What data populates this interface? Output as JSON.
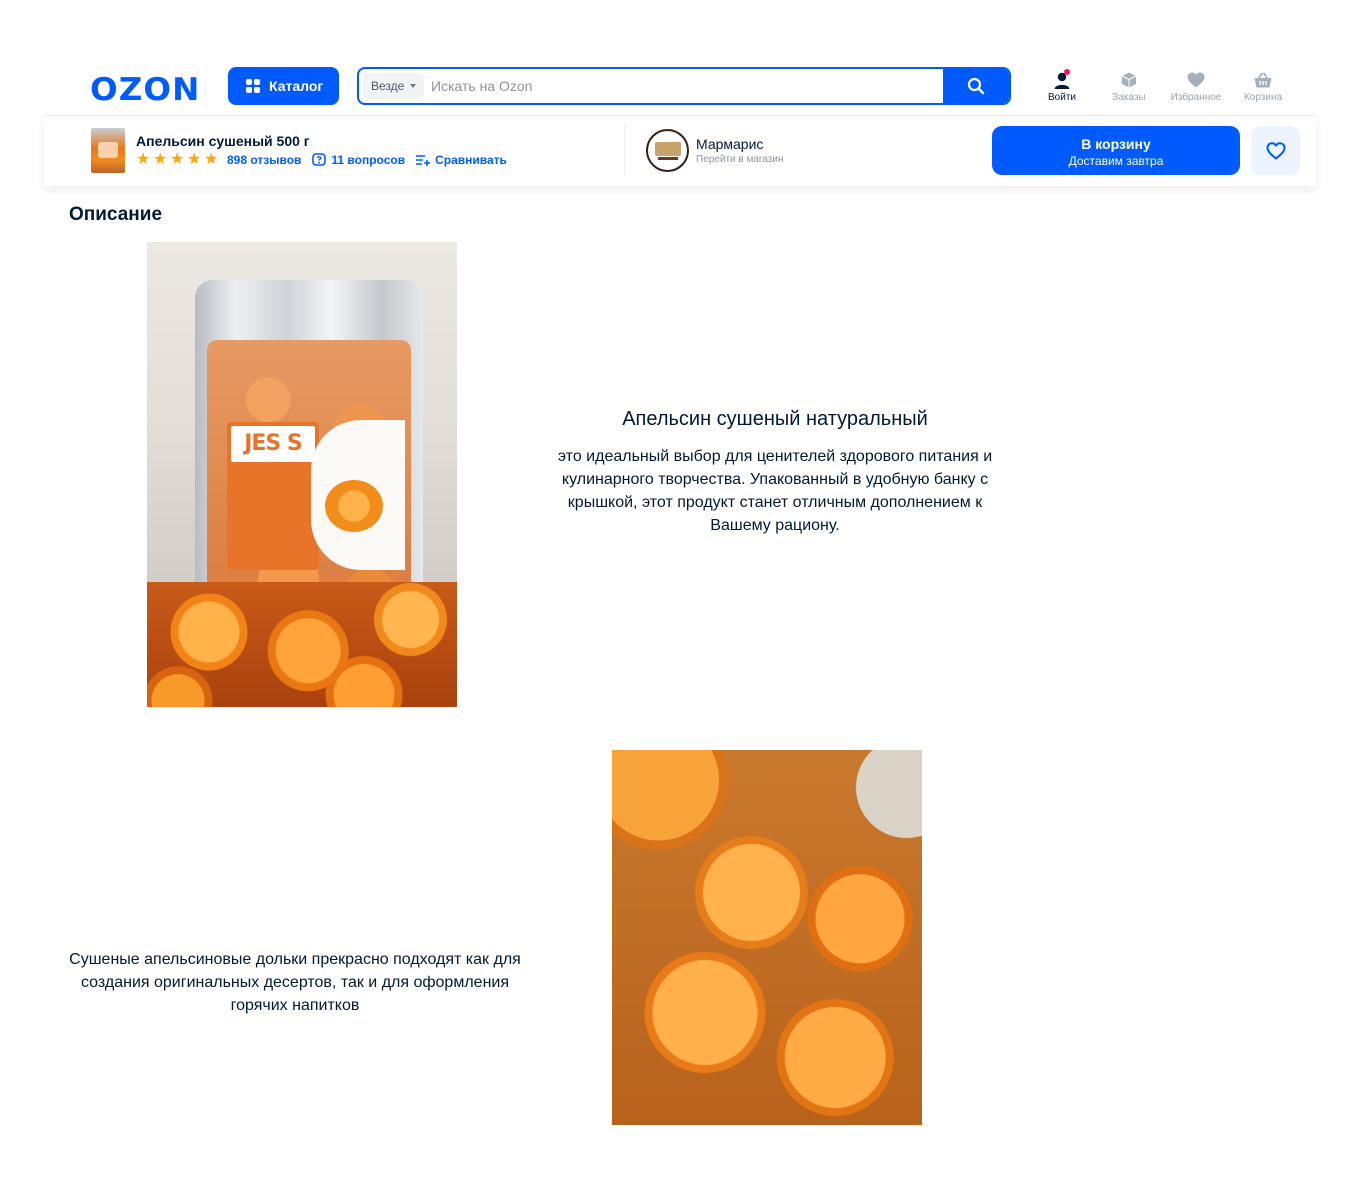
{
  "header": {
    "logo": "OZON",
    "catalog_label": "Каталог",
    "search": {
      "scope": "Везде",
      "placeholder": "Искать на Ozon"
    },
    "nav": [
      {
        "label": "Войти",
        "icon": "user-icon"
      },
      {
        "label": "Заказы",
        "icon": "box-icon"
      },
      {
        "label": "Избранное",
        "icon": "heart-icon"
      },
      {
        "label": "Корзина",
        "icon": "basket-icon"
      }
    ]
  },
  "product_bar": {
    "title": "Апельсин сушеный 500 г",
    "rating_stars": 5,
    "reviews": "898 отзывов",
    "questions": "11 вопросов",
    "compare": "Сравнивать",
    "seller": {
      "name": "Мармарис",
      "link": "Перейти в магазин"
    },
    "cart": {
      "label": "В корзину",
      "sub": "Доставим завтра"
    }
  },
  "description": {
    "title": "Описание",
    "block1": {
      "heading": "Апельсин сушеный натуральный",
      "text": "это идеальный выбор для ценителей здорового питания и кулинарного творчества. Упакованный в удобную банку с крышкой, этот продукт станет отличным дополнением к Вашему рациону."
    },
    "block2": {
      "text": "Сушеные апельсиновые дольки прекрасно подходят как для создания оригинальных десертов, так и для оформления горячих напитков"
    },
    "package_brand": "JES S"
  },
  "colors": {
    "accent": "#005bff",
    "text": "#001a34",
    "star": "#ffa800",
    "notification": "#f91155"
  }
}
